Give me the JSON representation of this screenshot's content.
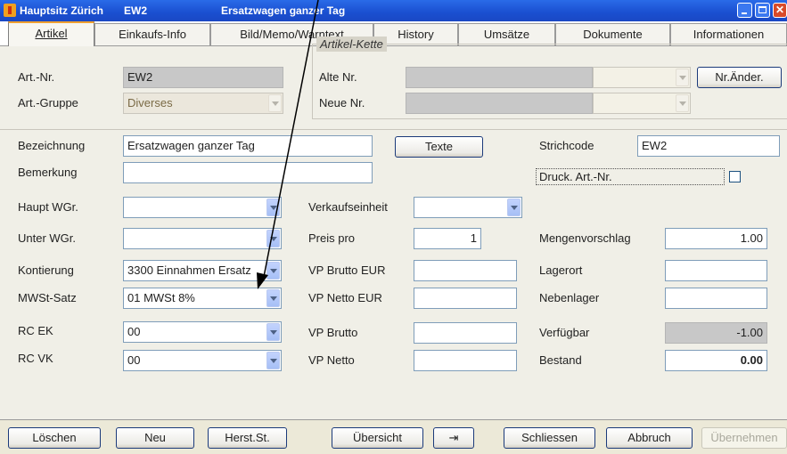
{
  "titlebar": {
    "part1": "Hauptsitz Zürich",
    "part2": "EW2",
    "part3": "Ersatzwagen ganzer Tag"
  },
  "tabs": [
    "Artikel",
    "Einkaufs-Info",
    "Bild/Memo/Warntext",
    "History",
    "Umsätze",
    "Dokumente",
    "Informationen"
  ],
  "group": {
    "title": "Artikel-Kette",
    "alte_nr": "Alte Nr.",
    "neue_nr": "Neue Nr."
  },
  "labels": {
    "art_nr": "Art.-Nr.",
    "art_gruppe": "Art.-Gruppe",
    "bezeichnung": "Bezeichnung",
    "bemerkung": "Bemerkung",
    "haupt_wgr": "Haupt WGr.",
    "unter_wgr": "Unter WGr.",
    "kontierung": "Kontierung",
    "mwst": "MWSt-Satz",
    "rc_ek": "RC EK",
    "rc_vk": "RC VK",
    "verkaufseinheit": "Verkaufseinheit",
    "preis_pro": "Preis pro",
    "vp_brutto_eur": "VP Brutto EUR",
    "vp_netto_eur": "VP Netto EUR",
    "vp_brutto": "VP Brutto",
    "vp_netto": "VP Netto",
    "strichcode": "Strichcode",
    "druck": "Druck. Art.-Nr.",
    "mengenvorschlag": "Mengenvorschlag",
    "lagerort": "Lagerort",
    "nebenlager": "Nebenlager",
    "verfuegbar": "Verfügbar",
    "bestand": "Bestand"
  },
  "values": {
    "art_nr": "EW2",
    "art_gruppe": "Diverses",
    "bezeichnung": "Ersatzwagen ganzer Tag",
    "bemerkung": "",
    "kontierung": "3300  Einnahmen Ersatz",
    "mwst": "01 MWSt 8%",
    "rc_ek": "00",
    "rc_vk": "00",
    "preis_pro": "1",
    "strichcode": "EW2",
    "mengenvorschlag": "1.00",
    "verfuegbar": "-1.00",
    "bestand": "0.00"
  },
  "buttons": {
    "nr_aender": "Nr.Änder.",
    "texte": "Texte",
    "loeschen": "Löschen",
    "neu": "Neu",
    "herst": "Herst.St.",
    "uebersicht": "Übersicht",
    "pin": "⇥",
    "schliessen": "Schliessen",
    "abbruch": "Abbruch",
    "uebernehmen": "Übernehmen"
  },
  "colors": {
    "titlebar": "#1a4fd0",
    "disabled_field": "#c8c8c8",
    "active_tab_accent": "#f0a030"
  },
  "icons": {
    "app": "app-icon",
    "minimize": "minimize-icon",
    "maximize": "maximize-icon",
    "close": "close-icon"
  }
}
